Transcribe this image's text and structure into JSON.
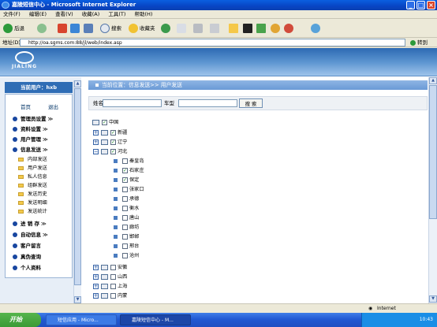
{
  "window": {
    "title": "嘉陵短信中心 - Microsoft Internet Explorer"
  },
  "menu": [
    "文件(F)",
    "编辑(E)",
    "查看(V)",
    "收藏(A)",
    "工具(T)",
    "帮助(H)"
  ],
  "toolbar": {
    "back": "后退",
    "search": "搜索",
    "favorites": "收藏夹"
  },
  "address": {
    "label": "地址(D)",
    "url": "http://oa.sgms.com:88/jl/web/index.asp",
    "go": "转到"
  },
  "logo": {
    "text": "JIALING"
  },
  "user": {
    "current": "当前用户：hxb"
  },
  "quick": {
    "home": "首页",
    "logout": "退出"
  },
  "nav": {
    "m1": "管理员设置",
    "m2": "资料设置",
    "m3": "用户管理",
    "m4": "信息发送",
    "subs": [
      "内部发送",
      "用户发送",
      "私人信息",
      "组群发送",
      "发送历史",
      "发送明细",
      "发送统计"
    ],
    "m5": "进 销 存",
    "m6": "自动信息",
    "m7": "客户留言",
    "m8": "真伪查询",
    "m9": "个人资料",
    "arrow": "≫",
    "arrow_open": "≫"
  },
  "location": "当前位置：信息发送>> 用户发送",
  "search": {
    "name_label": "姓名",
    "car_label": "车型",
    "button": "搜 索"
  },
  "tree": {
    "root": "中国",
    "p1": "新疆",
    "p2": "辽宁",
    "p3": "河北",
    "cities": [
      "秦皇岛",
      "石家庄",
      "保定",
      "张家口",
      "承德",
      "衡水",
      "唐山",
      "廊坊",
      "邯郸",
      "邢台",
      "沧州"
    ],
    "p4": "安徽",
    "p5": "山西",
    "p6": "上海",
    "p7": "内蒙"
  },
  "status": {
    "zone": "Internet"
  },
  "taskbar": {
    "start": "开始",
    "task1": "短信应用 - Micro...",
    "task2": "嘉陵短信中心 - M...",
    "clock": "10:43"
  }
}
